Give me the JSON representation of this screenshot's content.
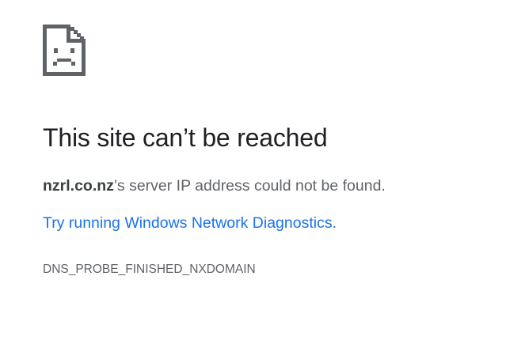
{
  "error_page": {
    "icon": "sad-page-icon",
    "title": "This site can’t be reached",
    "host": "nzrl.co.nz",
    "description_suffix": "’s server IP address could not be found.",
    "suggestion_link": "Try running Windows Network Diagnostics",
    "suggestion_period": ".",
    "error_code": "DNS_PROBE_FINISHED_NXDOMAIN"
  },
  "colors": {
    "title": "#202124",
    "body_text": "#5f6368",
    "link": "#1a73e8",
    "icon": "#5f6368"
  }
}
